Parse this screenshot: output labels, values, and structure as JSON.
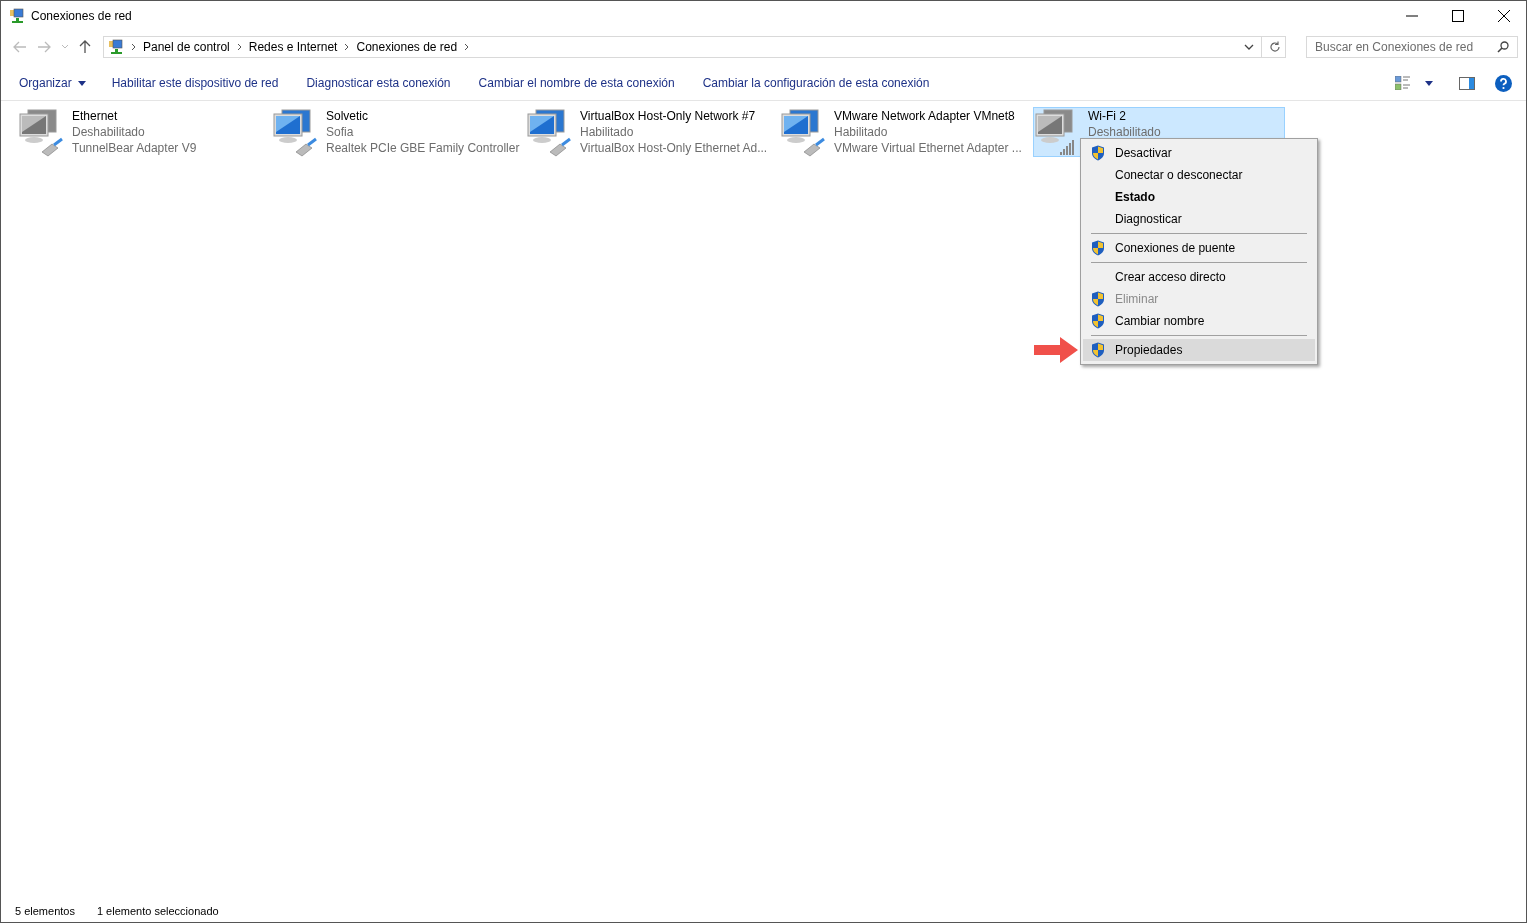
{
  "window": {
    "title": "Conexiones de red"
  },
  "address": {
    "crumbs": [
      "Panel de control",
      "Redes e Internet",
      "Conexiones de red"
    ],
    "search_placeholder": "Buscar en Conexiones de red"
  },
  "toolbar": {
    "organize": "Organizar",
    "commands": [
      "Habilitar este dispositivo de red",
      "Diagnosticar esta conexión",
      "Cambiar el nombre de esta conexión",
      "Cambiar la configuración de esta conexión"
    ]
  },
  "connections": [
    {
      "name": "Ethernet",
      "status": "Deshabilitado",
      "device": "TunnelBear Adapter V9",
      "kind": "ethernet",
      "enabled": false,
      "selected": false
    },
    {
      "name": "Solvetic",
      "status": "Sofia",
      "device": "Realtek PCIe GBE Family Controller",
      "kind": "ethernet",
      "enabled": true,
      "selected": false
    },
    {
      "name": "VirtualBox Host-Only Network #7",
      "status": "Habilitado",
      "device": "VirtualBox Host-Only Ethernet Ad...",
      "kind": "ethernet",
      "enabled": true,
      "selected": false
    },
    {
      "name": "VMware Network Adapter VMnet8",
      "status": "Habilitado",
      "device": "VMware Virtual Ethernet Adapter ...",
      "kind": "ethernet",
      "enabled": true,
      "selected": false
    },
    {
      "name": "Wi-Fi 2",
      "status": "Deshabilitado",
      "kind": "wifi",
      "enabled": false,
      "selected": true
    }
  ],
  "context_menu": {
    "groups": [
      [
        {
          "label": "Desactivar",
          "shield": true,
          "bold": false,
          "disabled": false,
          "selected": false
        },
        {
          "label": "Conectar o desconectar",
          "shield": false,
          "bold": false,
          "disabled": false,
          "selected": false
        },
        {
          "label": "Estado",
          "shield": false,
          "bold": true,
          "disabled": false,
          "selected": false
        },
        {
          "label": "Diagnosticar",
          "shield": false,
          "bold": false,
          "disabled": false,
          "selected": false
        }
      ],
      [
        {
          "label": "Conexiones de puente",
          "shield": true,
          "bold": false,
          "disabled": false,
          "selected": false
        }
      ],
      [
        {
          "label": "Crear acceso directo",
          "shield": false,
          "bold": false,
          "disabled": false,
          "selected": false
        },
        {
          "label": "Eliminar",
          "shield": true,
          "bold": false,
          "disabled": true,
          "selected": false
        },
        {
          "label": "Cambiar nombre",
          "shield": true,
          "bold": false,
          "disabled": false,
          "selected": false
        }
      ],
      [
        {
          "label": "Propiedades",
          "shield": true,
          "bold": false,
          "disabled": false,
          "selected": true
        }
      ]
    ]
  },
  "status_bar": {
    "count": "5 elementos",
    "selection": "1 elemento seleccionado"
  }
}
